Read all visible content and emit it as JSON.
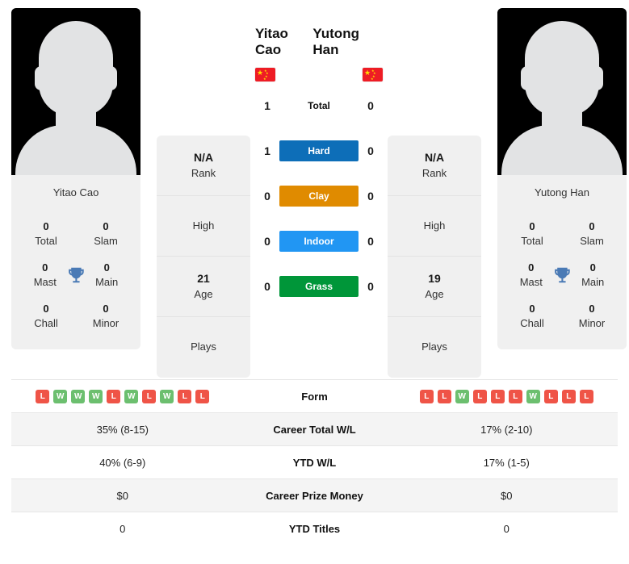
{
  "players": {
    "left": {
      "name": "Yitao Cao",
      "photo_name": "Yitao Cao",
      "flag": "china-flag",
      "rank": "N/A",
      "rank_label": "Rank",
      "high_label": "High",
      "high_value": "",
      "age": "21",
      "age_label": "Age",
      "plays_label": "Plays",
      "plays_value": "",
      "titles": {
        "total": "0",
        "total_label": "Total",
        "slam": "0",
        "slam_label": "Slam",
        "mast": "0",
        "mast_label": "Mast",
        "main": "0",
        "main_label": "Main",
        "chall": "0",
        "chall_label": "Chall",
        "minor": "0",
        "minor_label": "Minor"
      },
      "form": [
        "L",
        "W",
        "W",
        "W",
        "L",
        "W",
        "L",
        "W",
        "L",
        "L"
      ],
      "career_total_wl": "35% (8-15)",
      "ytd_wl": "40% (6-9)",
      "career_prize_money": "$0",
      "ytd_titles": "0"
    },
    "right": {
      "name": "Yutong Han",
      "photo_name": "Yutong Han",
      "flag": "china-flag",
      "rank": "N/A",
      "rank_label": "Rank",
      "high_label": "High",
      "high_value": "",
      "age": "19",
      "age_label": "Age",
      "plays_label": "Plays",
      "plays_value": "",
      "titles": {
        "total": "0",
        "total_label": "Total",
        "slam": "0",
        "slam_label": "Slam",
        "mast": "0",
        "mast_label": "Mast",
        "main": "0",
        "main_label": "Main",
        "chall": "0",
        "chall_label": "Chall",
        "minor": "0",
        "minor_label": "Minor"
      },
      "form": [
        "L",
        "L",
        "W",
        "L",
        "L",
        "L",
        "W",
        "L",
        "L",
        "L"
      ],
      "career_total_wl": "17% (2-10)",
      "ytd_wl": "17% (1-5)",
      "career_prize_money": "$0",
      "ytd_titles": "0"
    }
  },
  "h2h": {
    "rows": [
      {
        "label": "Total",
        "left": "1",
        "right": "0",
        "color": "",
        "text_color": "#111111"
      },
      {
        "label": "Hard",
        "left": "1",
        "right": "0",
        "color": "#0d6eb8",
        "text_color": "#ffffff"
      },
      {
        "label": "Clay",
        "left": "0",
        "right": "0",
        "color": "#e08b00",
        "text_color": "#ffffff"
      },
      {
        "label": "Indoor",
        "left": "0",
        "right": "0",
        "color": "#2196f3",
        "text_color": "#ffffff"
      },
      {
        "label": "Grass",
        "left": "0",
        "right": "0",
        "color": "#009639",
        "text_color": "#ffffff"
      }
    ]
  },
  "table": {
    "rows": [
      {
        "label": "Form"
      },
      {
        "label": "Career Total W/L"
      },
      {
        "label": "YTD W/L"
      },
      {
        "label": "Career Prize Money"
      },
      {
        "label": "YTD Titles"
      }
    ]
  },
  "colors": {
    "win_badge": "#6cbf6f",
    "loss_badge": "#ef5447",
    "trophy": "#4a7ab5",
    "flag_red": "#ee1c25",
    "flag_star": "#ffde00",
    "card_bg": "#f0f0f0",
    "row_alt_bg": "#f4f4f4"
  }
}
